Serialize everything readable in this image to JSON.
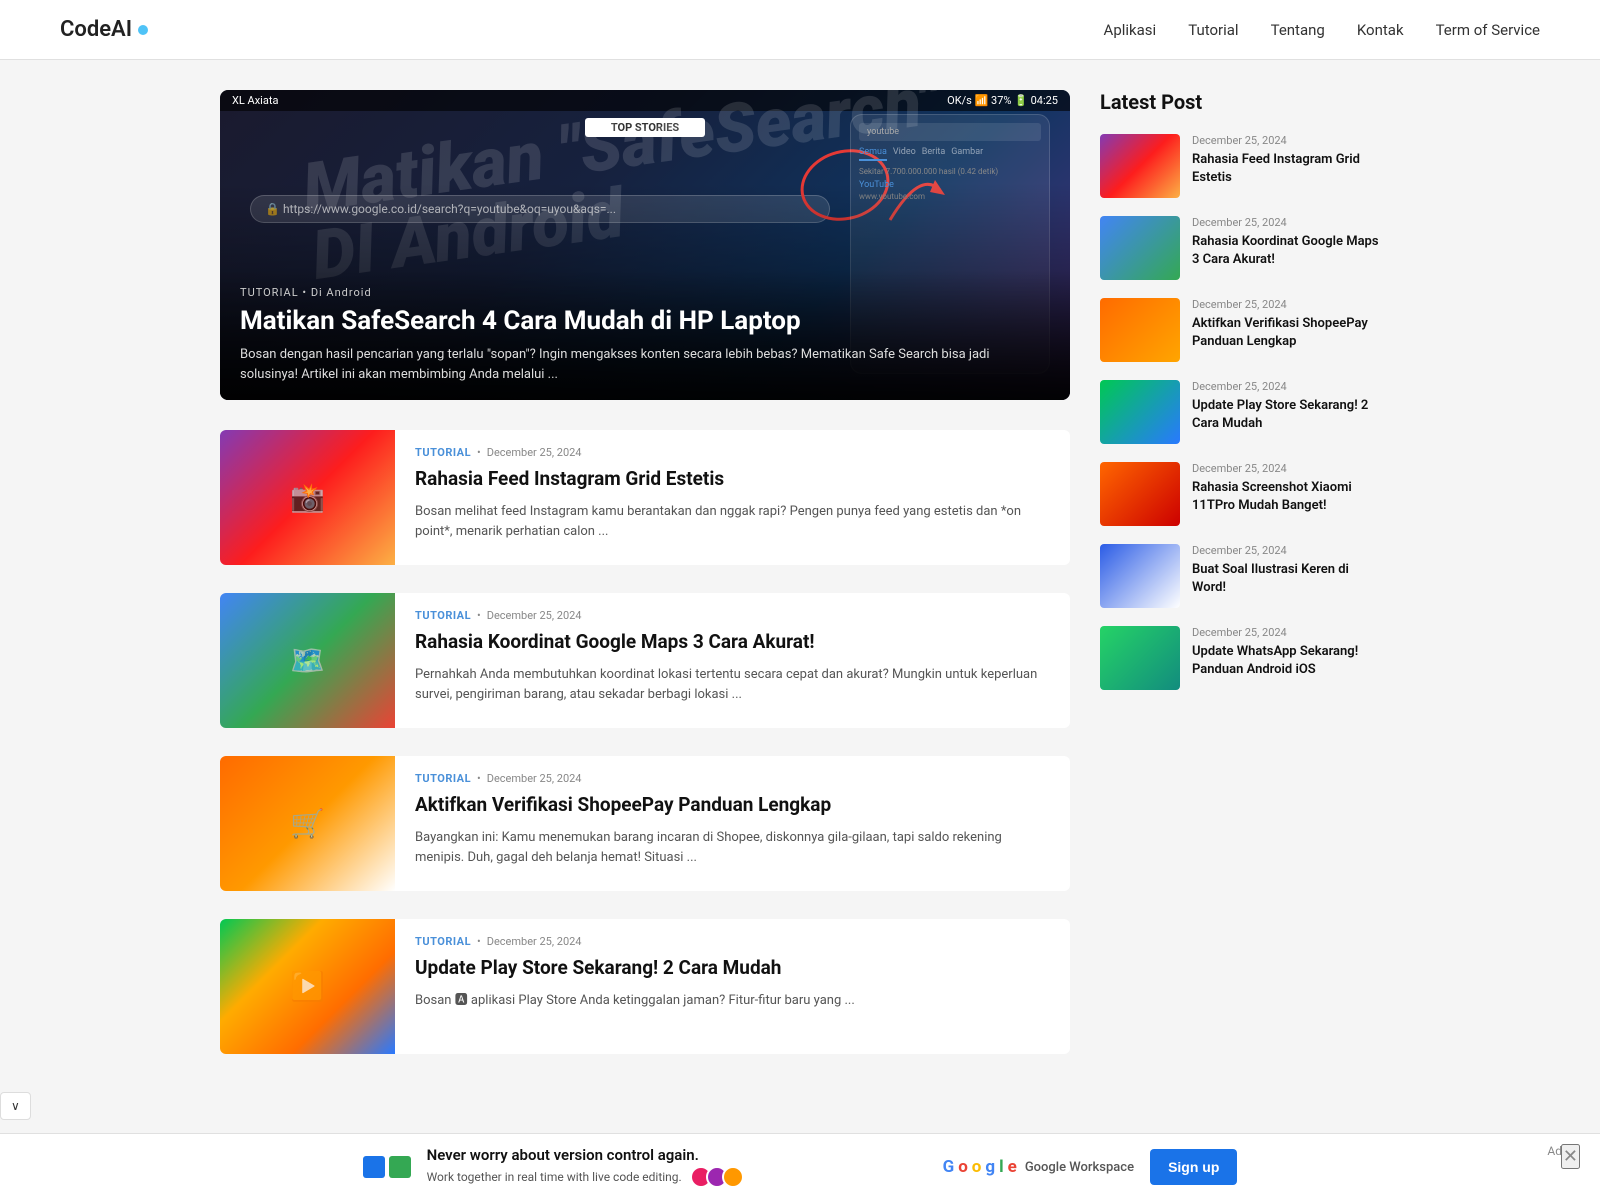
{
  "header": {
    "logo": "CodeAI",
    "nav": [
      {
        "label": "Aplikasi",
        "id": "nav-aplikasi"
      },
      {
        "label": "Tutorial",
        "id": "nav-tutorial"
      },
      {
        "label": "Tentang",
        "id": "nav-tentang"
      },
      {
        "label": "Kontak",
        "id": "nav-kontak"
      },
      {
        "label": "Term of Service",
        "id": "nav-tos"
      }
    ]
  },
  "hero": {
    "label": "TUTORIAL  •  Di Android",
    "title": "Matikan SafeSearch 4 Cara Mudah di HP Laptop",
    "excerpt": "Bosan dengan hasil pencarian yang terlalu \"sopan\"? Ingin mengakses konten secara lebih bebas? Mematikan Safe Search bisa jadi solusinya! Artikel ini akan membimbing Anda melalui ...",
    "status_bar": {
      "carrier": "XL Axiata",
      "time": "04:25",
      "signal": "37%"
    },
    "top_stories": "TOP STORIES",
    "search_url": "https://www.google.co.id/search?q=youtube&oq=uyou&aqs=..."
  },
  "articles": [
    {
      "tag": "TUTORIAL",
      "date": "December 25, 2024",
      "title": "Rahasia Feed Instagram Grid Estetis",
      "excerpt": "Bosan melihat feed Instagram kamu berantakan dan nggak rapi? Pengen punya feed yang estetis dan *on point*, menarik perhatian calon ...",
      "thumb_class": "thumb-instagram",
      "thumb_icon": "📸"
    },
    {
      "tag": "TUTORIAL",
      "date": "December 25, 2024",
      "title": "Rahasia Koordinat Google Maps 3 Cara Akurat!",
      "excerpt": "Pernahkah Anda membutuhkan koordinat lokasi tertentu secara cepat dan akurat? Mungkin untuk keperluan survei, pengiriman barang, atau sekadar berbagi lokasi ...",
      "thumb_class": "thumb-maps",
      "thumb_icon": "🗺️"
    },
    {
      "tag": "TUTORIAL",
      "date": "December 25, 2024",
      "title": "Aktifkan Verifikasi ShopeePay Panduan Lengkap",
      "excerpt": "Bayangkan ini: Kamu menemukan barang incaran di Shopee, diskonnya gila-gilaan, tapi saldo rekening menipis. Duh, gagal deh belanja hemat! Situasi ...",
      "thumb_class": "thumb-shopee",
      "thumb_icon": "🛒"
    },
    {
      "tag": "TUTORIAL",
      "date": "December 25, 2024",
      "title": "Update Play Store Sekarang! 2 Cara Mudah",
      "excerpt": "Bosan 🅰 aplikasi Play Store Anda ketinggalan jaman? Fitur-fitur baru yang ...",
      "thumb_class": "thumb-playstore",
      "thumb_icon": "▶️"
    }
  ],
  "sidebar": {
    "title": "Latest Post",
    "items": [
      {
        "date": "December 25, 2024",
        "title": "Rahasia Feed Instagram Grid Estetis",
        "thumb_class": "st-instagram"
      },
      {
        "date": "December 25, 2024",
        "title": "Rahasia Koordinat Google Maps 3 Cara Akurat!",
        "thumb_class": "st-maps"
      },
      {
        "date": "December 25, 2024",
        "title": "Aktifkan Verifikasi ShopeePay Panduan Lengkap",
        "thumb_class": "st-shopee"
      },
      {
        "date": "December 25, 2024",
        "title": "Update Play Store Sekarang! 2 Cara Mudah",
        "thumb_class": "st-playstore"
      },
      {
        "date": "December 25, 2024",
        "title": "Rahasia Screenshot Xiaomi 11TPro Mudah Banget!",
        "thumb_class": "st-xiaomi"
      },
      {
        "date": "December 25, 2024",
        "title": "Buat Soal Ilustrasi Keren di Word!",
        "thumb_class": "st-word"
      },
      {
        "date": "December 25, 2024",
        "title": "Update WhatsApp Sekarang! Panduan Android iOS",
        "thumb_class": "st-whatsapp"
      }
    ]
  },
  "ad": {
    "headline": "Never worry about version control again.",
    "subline": "Work together in real time with live code editing.",
    "google_label": "Google Workspace",
    "signup_label": "Sign up",
    "close_label": "✕",
    "ad_label": "Ad"
  },
  "scroll_indicator": "∨"
}
